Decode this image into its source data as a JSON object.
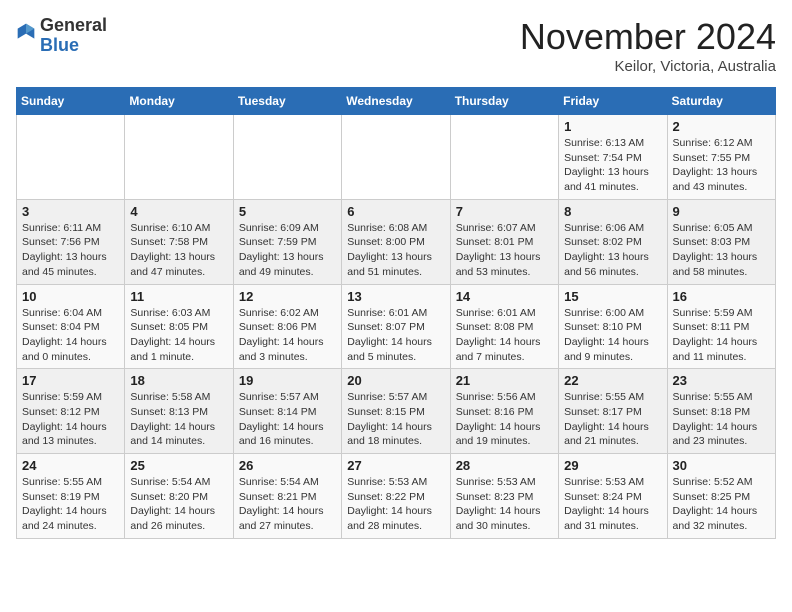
{
  "header": {
    "logo_general": "General",
    "logo_blue": "Blue",
    "month": "November 2024",
    "location": "Keilor, Victoria, Australia"
  },
  "calendar": {
    "days_of_week": [
      "Sunday",
      "Monday",
      "Tuesday",
      "Wednesday",
      "Thursday",
      "Friday",
      "Saturday"
    ],
    "weeks": [
      [
        {
          "day": "",
          "info": ""
        },
        {
          "day": "",
          "info": ""
        },
        {
          "day": "",
          "info": ""
        },
        {
          "day": "",
          "info": ""
        },
        {
          "day": "",
          "info": ""
        },
        {
          "day": "1",
          "info": "Sunrise: 6:13 AM\nSunset: 7:54 PM\nDaylight: 13 hours and 41 minutes."
        },
        {
          "day": "2",
          "info": "Sunrise: 6:12 AM\nSunset: 7:55 PM\nDaylight: 13 hours and 43 minutes."
        }
      ],
      [
        {
          "day": "3",
          "info": "Sunrise: 6:11 AM\nSunset: 7:56 PM\nDaylight: 13 hours and 45 minutes."
        },
        {
          "day": "4",
          "info": "Sunrise: 6:10 AM\nSunset: 7:58 PM\nDaylight: 13 hours and 47 minutes."
        },
        {
          "day": "5",
          "info": "Sunrise: 6:09 AM\nSunset: 7:59 PM\nDaylight: 13 hours and 49 minutes."
        },
        {
          "day": "6",
          "info": "Sunrise: 6:08 AM\nSunset: 8:00 PM\nDaylight: 13 hours and 51 minutes."
        },
        {
          "day": "7",
          "info": "Sunrise: 6:07 AM\nSunset: 8:01 PM\nDaylight: 13 hours and 53 minutes."
        },
        {
          "day": "8",
          "info": "Sunrise: 6:06 AM\nSunset: 8:02 PM\nDaylight: 13 hours and 56 minutes."
        },
        {
          "day": "9",
          "info": "Sunrise: 6:05 AM\nSunset: 8:03 PM\nDaylight: 13 hours and 58 minutes."
        }
      ],
      [
        {
          "day": "10",
          "info": "Sunrise: 6:04 AM\nSunset: 8:04 PM\nDaylight: 14 hours and 0 minutes."
        },
        {
          "day": "11",
          "info": "Sunrise: 6:03 AM\nSunset: 8:05 PM\nDaylight: 14 hours and 1 minute."
        },
        {
          "day": "12",
          "info": "Sunrise: 6:02 AM\nSunset: 8:06 PM\nDaylight: 14 hours and 3 minutes."
        },
        {
          "day": "13",
          "info": "Sunrise: 6:01 AM\nSunset: 8:07 PM\nDaylight: 14 hours and 5 minutes."
        },
        {
          "day": "14",
          "info": "Sunrise: 6:01 AM\nSunset: 8:08 PM\nDaylight: 14 hours and 7 minutes."
        },
        {
          "day": "15",
          "info": "Sunrise: 6:00 AM\nSunset: 8:10 PM\nDaylight: 14 hours and 9 minutes."
        },
        {
          "day": "16",
          "info": "Sunrise: 5:59 AM\nSunset: 8:11 PM\nDaylight: 14 hours and 11 minutes."
        }
      ],
      [
        {
          "day": "17",
          "info": "Sunrise: 5:59 AM\nSunset: 8:12 PM\nDaylight: 14 hours and 13 minutes."
        },
        {
          "day": "18",
          "info": "Sunrise: 5:58 AM\nSunset: 8:13 PM\nDaylight: 14 hours and 14 minutes."
        },
        {
          "day": "19",
          "info": "Sunrise: 5:57 AM\nSunset: 8:14 PM\nDaylight: 14 hours and 16 minutes."
        },
        {
          "day": "20",
          "info": "Sunrise: 5:57 AM\nSunset: 8:15 PM\nDaylight: 14 hours and 18 minutes."
        },
        {
          "day": "21",
          "info": "Sunrise: 5:56 AM\nSunset: 8:16 PM\nDaylight: 14 hours and 19 minutes."
        },
        {
          "day": "22",
          "info": "Sunrise: 5:55 AM\nSunset: 8:17 PM\nDaylight: 14 hours and 21 minutes."
        },
        {
          "day": "23",
          "info": "Sunrise: 5:55 AM\nSunset: 8:18 PM\nDaylight: 14 hours and 23 minutes."
        }
      ],
      [
        {
          "day": "24",
          "info": "Sunrise: 5:55 AM\nSunset: 8:19 PM\nDaylight: 14 hours and 24 minutes."
        },
        {
          "day": "25",
          "info": "Sunrise: 5:54 AM\nSunset: 8:20 PM\nDaylight: 14 hours and 26 minutes."
        },
        {
          "day": "26",
          "info": "Sunrise: 5:54 AM\nSunset: 8:21 PM\nDaylight: 14 hours and 27 minutes."
        },
        {
          "day": "27",
          "info": "Sunrise: 5:53 AM\nSunset: 8:22 PM\nDaylight: 14 hours and 28 minutes."
        },
        {
          "day": "28",
          "info": "Sunrise: 5:53 AM\nSunset: 8:23 PM\nDaylight: 14 hours and 30 minutes."
        },
        {
          "day": "29",
          "info": "Sunrise: 5:53 AM\nSunset: 8:24 PM\nDaylight: 14 hours and 31 minutes."
        },
        {
          "day": "30",
          "info": "Sunrise: 5:52 AM\nSunset: 8:25 PM\nDaylight: 14 hours and 32 minutes."
        }
      ]
    ]
  }
}
